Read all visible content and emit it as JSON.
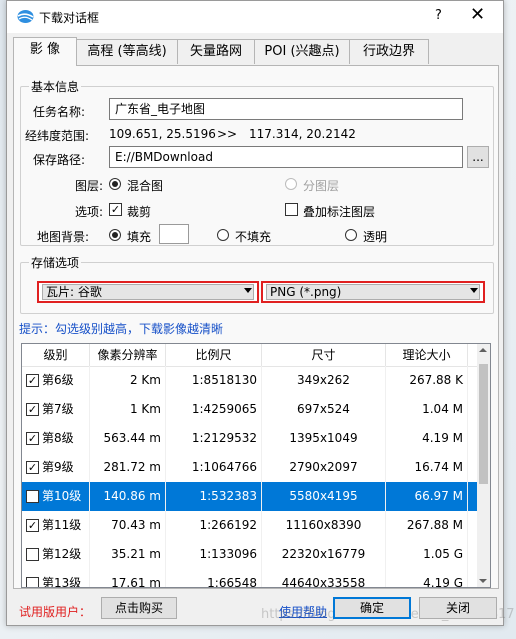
{
  "window": {
    "title": "下载对话框",
    "help_label": "?",
    "close_label": "✕"
  },
  "tabs": [
    {
      "label": "影 像",
      "active": true
    },
    {
      "label": "高程 (等高线)",
      "active": false
    },
    {
      "label": "矢量路网",
      "active": false
    },
    {
      "label": "POI (兴趣点)",
      "active": false
    },
    {
      "label": "行政边界",
      "active": false
    }
  ],
  "basic": {
    "legend": "基本信息",
    "task_label": "任务名称:",
    "task_value": "广东省_电子地图",
    "range_label": "经纬度范围:",
    "range_from": "109.651, 25.5196",
    "range_sep": ">>",
    "range_to": "117.314, 20.2142",
    "path_label": "保存路径:",
    "path_value": "E://BMDownload",
    "browse_label": "...",
    "layer_label": "图层:",
    "layer_mixed": "混合图",
    "layer_split": "分图层",
    "option_label": "选项:",
    "option_clip": "裁剪",
    "option_overlay": "叠加标注图层",
    "bg_label": "地图背景:",
    "bg_fill": "填充",
    "bg_nofill": "不填充",
    "bg_transparent": "透明"
  },
  "storage": {
    "legend": "存储选项",
    "tile_select": "瓦片: 谷歌",
    "format_select": "PNG (*.png)"
  },
  "hint": "提示：勾选级别越高，下载影像越清晰",
  "table": {
    "headers": [
      "级别",
      "像素分辨率",
      "比例尺",
      "尺寸",
      "理论大小"
    ],
    "rows": [
      {
        "checked": true,
        "level": "第6级",
        "res": "2 Km",
        "scale": "1:8518130",
        "size": "349x262",
        "theory": "267.88 K",
        "selected": false
      },
      {
        "checked": true,
        "level": "第7级",
        "res": "1 Km",
        "scale": "1:4259065",
        "size": "697x524",
        "theory": "1.04 M",
        "selected": false
      },
      {
        "checked": true,
        "level": "第8级",
        "res": "563.44 m",
        "scale": "1:2129532",
        "size": "1395x1049",
        "theory": "4.19 M",
        "selected": false
      },
      {
        "checked": true,
        "level": "第9级",
        "res": "281.72 m",
        "scale": "1:1064766",
        "size": "2790x2097",
        "theory": "16.74 M",
        "selected": false
      },
      {
        "checked": true,
        "level": "第10级",
        "res": "140.86 m",
        "scale": "1:532383",
        "size": "5580x4195",
        "theory": "66.97 M",
        "selected": true
      },
      {
        "checked": true,
        "level": "第11级",
        "res": "70.43 m",
        "scale": "1:266192",
        "size": "11160x8390",
        "theory": "267.88 M",
        "selected": false
      },
      {
        "checked": false,
        "level": "第12级",
        "res": "35.21 m",
        "scale": "1:133096",
        "size": "22320x16779",
        "theory": "1.05 G",
        "selected": false
      },
      {
        "checked": false,
        "level": "第13级",
        "res": "17.61 m",
        "scale": "1:66548",
        "size": "44640x33558",
        "theory": "4.19 G",
        "selected": false
      }
    ]
  },
  "footer": {
    "trial": "试用版用户：",
    "buy": "点击购买",
    "help": "使用帮助",
    "ok": "确定",
    "close": "关闭"
  },
  "watermark": "https://blog.csdn.net/weixin_44059417",
  "colors": {
    "selection": "#0078d7",
    "highlight_border": "#e02020",
    "link": "#1650c8"
  }
}
